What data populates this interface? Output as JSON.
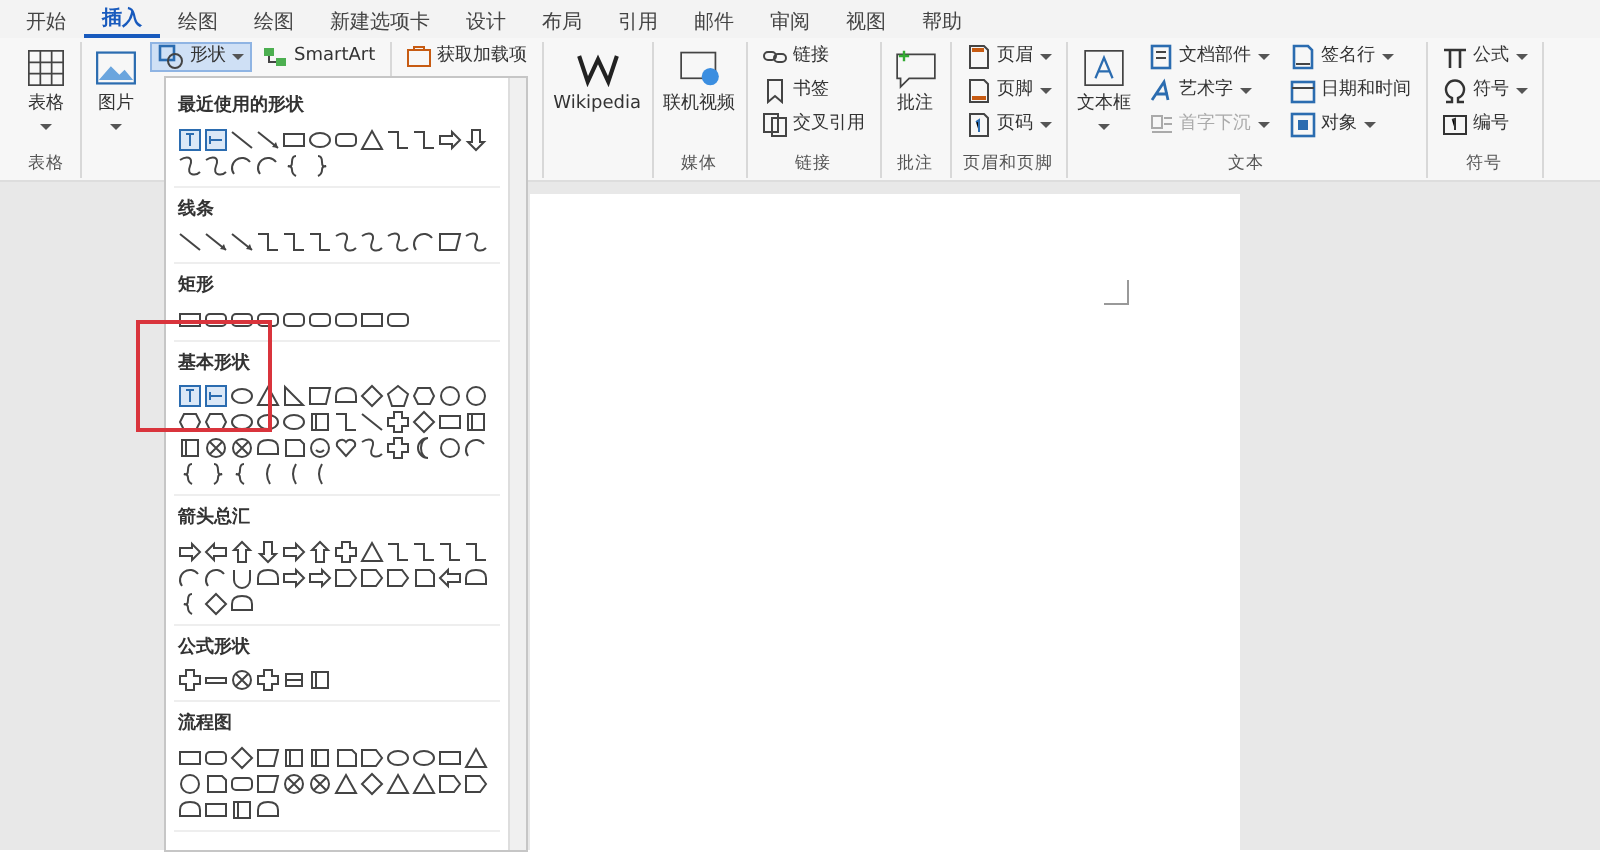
{
  "tabs": [
    {
      "label": "开始",
      "selected": false
    },
    {
      "label": "插入",
      "selected": true
    },
    {
      "label": "绘图",
      "selected": false
    },
    {
      "label": "绘图",
      "selected": false
    },
    {
      "label": "新建选项卡",
      "selected": false
    },
    {
      "label": "设计",
      "selected": false
    },
    {
      "label": "布局",
      "selected": false
    },
    {
      "label": "引用",
      "selected": false
    },
    {
      "label": "邮件",
      "selected": false
    },
    {
      "label": "审阅",
      "selected": false
    },
    {
      "label": "视图",
      "selected": false
    },
    {
      "label": "帮助",
      "selected": false
    }
  ],
  "ribbon": {
    "groups": [
      {
        "label": "表格",
        "columns": [
          {
            "kind": "large",
            "items": [
              {
                "label": "表格",
                "dropdown": true
              }
            ]
          }
        ]
      },
      {
        "columns": [
          {
            "kind": "large",
            "items": [
              {
                "label": "图片",
                "dropdown": true
              }
            ]
          },
          {
            "kind": "row",
            "items": [
              {
                "label": "形状",
                "dropdown": true,
                "pressed": true
              },
              {
                "label": "SmartArt"
              }
            ]
          }
        ]
      },
      {
        "columns": [
          {
            "kind": "small",
            "items": [
              {
                "label": "获取加载项"
              }
            ]
          }
        ]
      },
      {
        "columns": [
          {
            "kind": "large",
            "items": [
              {
                "label": "Wikipedia"
              }
            ]
          }
        ]
      },
      {
        "label": "媒体",
        "columns": [
          {
            "kind": "large",
            "items": [
              {
                "label": "联机视频"
              }
            ]
          }
        ]
      },
      {
        "label": "链接",
        "columns": [
          {
            "kind": "small",
            "items": [
              {
                "label": "链接"
              },
              {
                "label": "书签"
              },
              {
                "label": "交叉引用"
              }
            ]
          }
        ]
      },
      {
        "label": "批注",
        "columns": [
          {
            "kind": "large",
            "items": [
              {
                "label": "批注"
              }
            ]
          }
        ]
      },
      {
        "label": "页眉和页脚",
        "columns": [
          {
            "kind": "small",
            "items": [
              {
                "label": "页眉",
                "dropdown": true
              },
              {
                "label": "页脚",
                "dropdown": true
              },
              {
                "label": "页码",
                "dropdown": true
              }
            ]
          }
        ]
      },
      {
        "label": "文本",
        "columns": [
          {
            "kind": "large",
            "items": [
              {
                "label": "文本框",
                "dropdown": true
              }
            ]
          },
          {
            "kind": "small",
            "items": [
              {
                "label": "文档部件",
                "dropdown": true
              },
              {
                "label": "艺术字",
                "dropdown": true
              },
              {
                "label": "首字下沉",
                "dropdown": true,
                "disabled": true
              }
            ]
          },
          {
            "kind": "small",
            "items": [
              {
                "label": "签名行",
                "dropdown": true
              },
              {
                "label": "日期和时间"
              },
              {
                "label": "对象",
                "dropdown": true
              }
            ]
          }
        ]
      },
      {
        "label": "符号",
        "columns": [
          {
            "kind": "small",
            "items": [
              {
                "label": "公式",
                "dropdown": true
              },
              {
                "label": "符号",
                "dropdown": true
              },
              {
                "label": "编号"
              }
            ]
          }
        ]
      }
    ]
  },
  "shapes_menu": {
    "sections": [
      {
        "title": "最近使用的形状"
      },
      {
        "title": "线条"
      },
      {
        "title": "矩形"
      },
      {
        "title": "基本形状"
      },
      {
        "title": "箭头总汇"
      },
      {
        "title": "公式形状"
      },
      {
        "title": "流程图"
      }
    ]
  }
}
